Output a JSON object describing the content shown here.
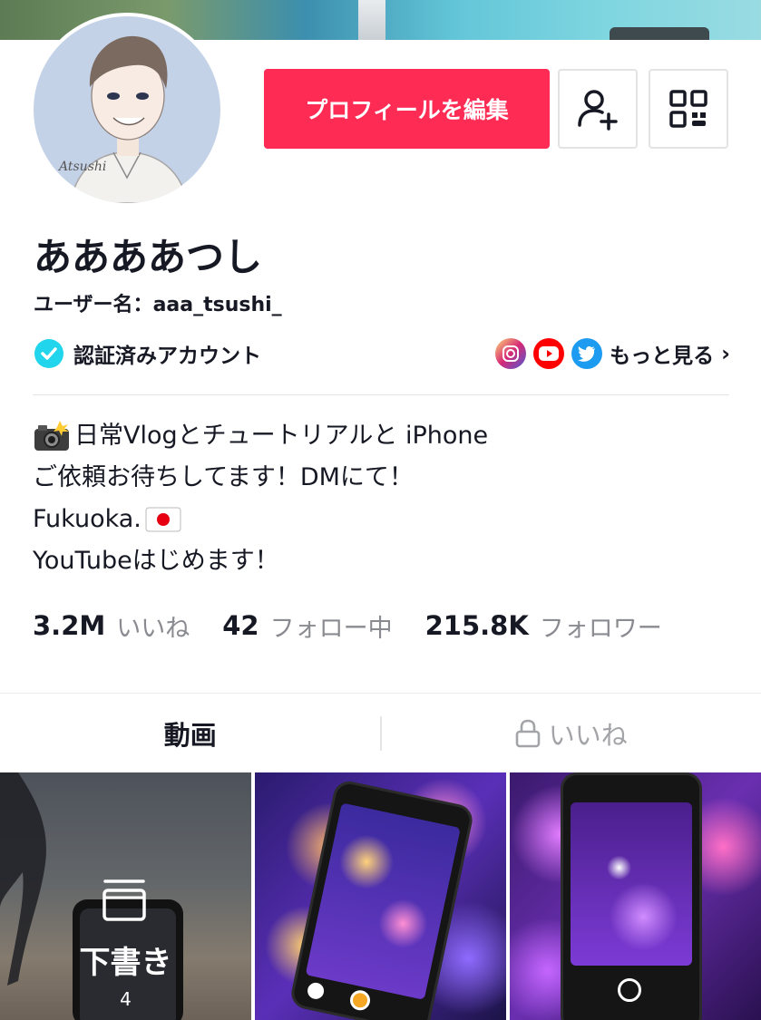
{
  "profile": {
    "display_name": "ああああつし",
    "username_label": "ユーザー名：",
    "username": "aaa_tsushi_",
    "verified_label": "認証済みアカウント",
    "more_label": "もっと見る"
  },
  "actions": {
    "edit_profile": "プロフィールを編集"
  },
  "bio": {
    "line1": "日常Vlogとチュートリアルと iPhone",
    "line2": "ご依頼お待ちしてます！DMにて！",
    "line3": "Fukuoka.",
    "line4": "YouTubeはじめます！"
  },
  "stats": {
    "likes_value": "3.2M",
    "likes_label": "いいね",
    "following_value": "42",
    "following_label": "フォロー中",
    "followers_value": "215.8K",
    "followers_label": "フォロワー"
  },
  "tabs": {
    "videos": "動画",
    "liked": "いいね"
  },
  "grid": {
    "draft_label": "下書き",
    "draft_count": "4"
  },
  "colors": {
    "accent": "#fe2c55",
    "verified": "#20d5ec",
    "muted_text": "#8a8b91",
    "instagram": "#c13584",
    "youtube": "#ff0000",
    "twitter": "#1d9bf0"
  },
  "icons": {
    "add_friend": "person-plus-icon",
    "qr": "qr-code-icon",
    "verified": "verified-badge-icon",
    "lock": "lock-icon",
    "drafts": "drafts-box-icon"
  }
}
